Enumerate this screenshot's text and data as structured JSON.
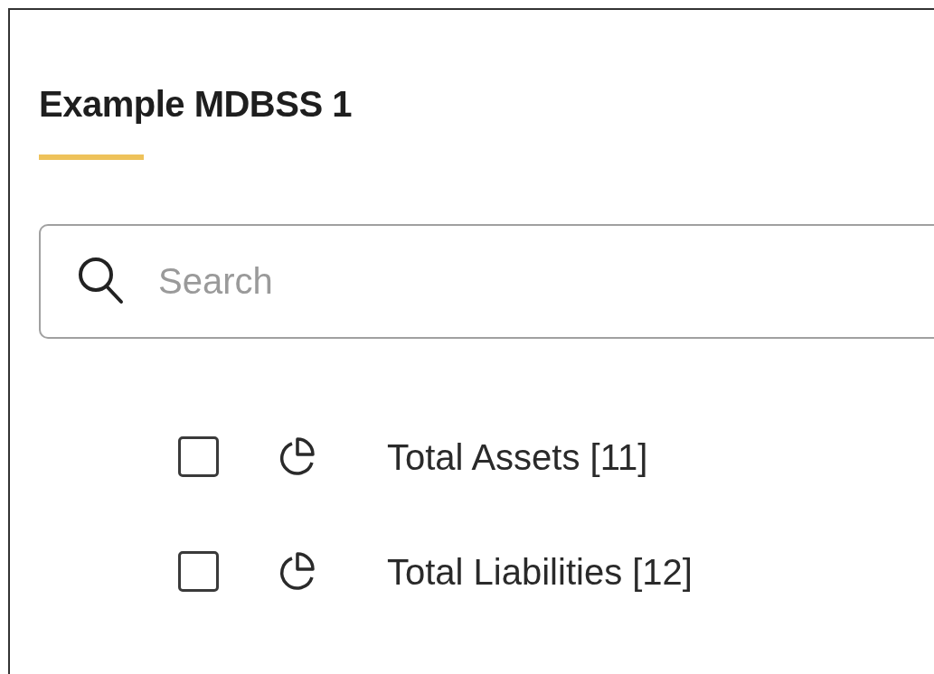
{
  "title": "Example MDBSS 1",
  "search": {
    "placeholder": "Search"
  },
  "items": [
    {
      "label": "Total Assets [11]",
      "checked": false
    },
    {
      "label": "Total Liabilities [12]",
      "checked": false
    }
  ]
}
